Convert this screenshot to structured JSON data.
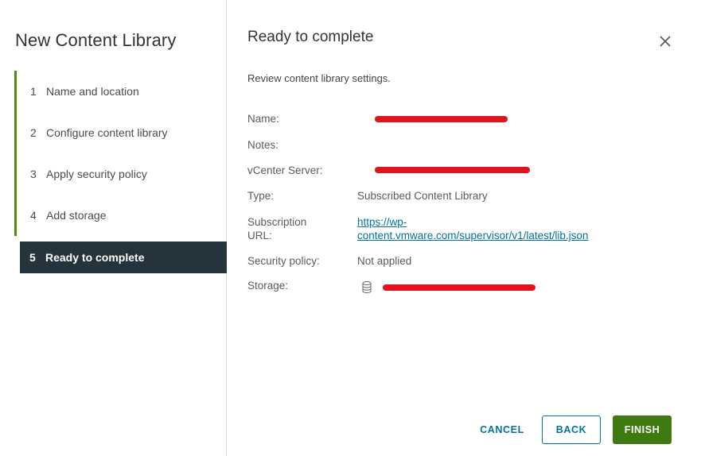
{
  "wizard": {
    "title": "New Content Library",
    "steps": [
      {
        "num": "1",
        "label": "Name and location",
        "state": "done"
      },
      {
        "num": "2",
        "label": "Configure content library",
        "state": "done"
      },
      {
        "num": "3",
        "label": "Apply security policy",
        "state": "done"
      },
      {
        "num": "4",
        "label": "Add storage",
        "state": "done"
      },
      {
        "num": "5",
        "label": "Ready to complete",
        "state": "active"
      }
    ]
  },
  "page": {
    "title": "Ready to complete",
    "subtitle": "Review content library settings.",
    "close_icon": "close-icon"
  },
  "settings": {
    "name_label": "Name:",
    "name_value": "[redacted]",
    "notes_label": "Notes:",
    "notes_value": "",
    "vcenter_label": "vCenter Server:",
    "vcenter_value": "[redacted]",
    "type_label": "Type:",
    "type_value": "Subscribed Content Library",
    "url_label_line1": "Subscription",
    "url_label_line2": "URL:",
    "url_value_line1": "https://wp-",
    "url_value_line2": "content.vmware.com/supervisor/v1/latest/lib.json",
    "security_label": "Security policy:",
    "security_value": "Not applied",
    "storage_label": "Storage:",
    "storage_icon": "datastore-icon",
    "storage_value": "[redacted]"
  },
  "footer": {
    "cancel_label": "CANCEL",
    "back_label": "BACK",
    "finish_label": "FINISH"
  },
  "colors": {
    "step_done_bar": "#4f8a10",
    "step_active_bg": "#25333d",
    "link": "#0072a3",
    "finish_bg": "#3f7a10",
    "redaction": "#e0151b"
  }
}
